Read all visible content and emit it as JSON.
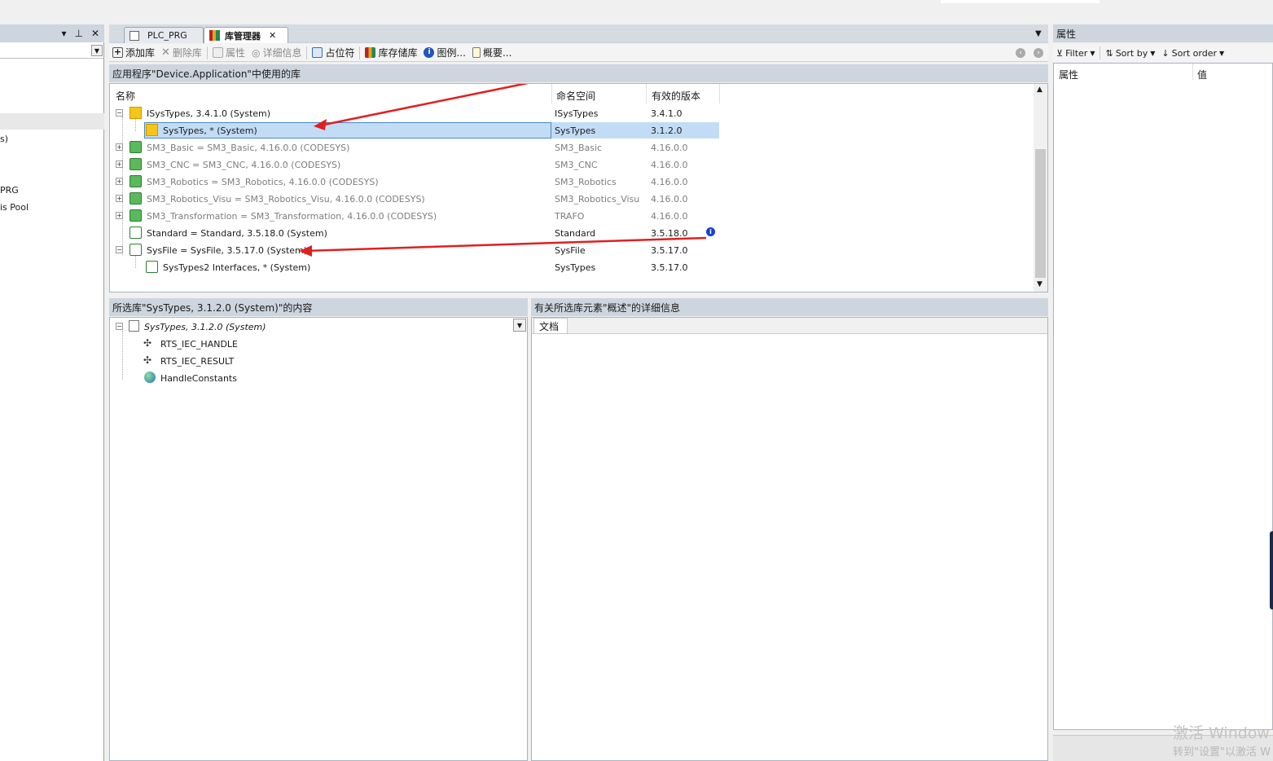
{
  "tabs": [
    {
      "label": "PLC_PRG"
    },
    {
      "label": "库管理器"
    }
  ],
  "left_panel": {
    "items": [
      "s)",
      "PRG",
      "is Pool"
    ]
  },
  "toolbar": {
    "add": "添加库",
    "remove": "删除库",
    "properties": "属性",
    "details": "详细信息",
    "placeholders": "占位符",
    "repository": "库存储库",
    "icons": "图例...",
    "summary": "概要..."
  },
  "libs_header": "应用程序\"Device.Application\"中使用的库",
  "columns": {
    "name": "名称",
    "namespace": "命名空间",
    "version": "有效的版本"
  },
  "libraries": [
    {
      "name": "ISysTypes, 3.4.1.0 (System)",
      "namespace": "ISysTypes",
      "version": "3.4.1.0"
    },
    {
      "name": "SysTypes, * (System)",
      "namespace": "SysTypes",
      "version": "3.1.2.0"
    },
    {
      "name": "SM3_Basic = SM3_Basic, 4.16.0.0 (CODESYS)",
      "namespace": "SM3_Basic",
      "version": "4.16.0.0"
    },
    {
      "name": "SM3_CNC = SM3_CNC, 4.16.0.0 (CODESYS)",
      "namespace": "SM3_CNC",
      "version": "4.16.0.0"
    },
    {
      "name": "SM3_Robotics = SM3_Robotics, 4.16.0.0 (CODESYS)",
      "namespace": "SM3_Robotics",
      "version": "4.16.0.0"
    },
    {
      "name": "SM3_Robotics_Visu = SM3_Robotics_Visu, 4.16.0.0 (CODESYS)",
      "namespace": "SM3_Robotics_Visu",
      "version": "4.16.0.0"
    },
    {
      "name": "SM3_Transformation = SM3_Transformation, 4.16.0.0 (CODESYS)",
      "namespace": "TRAFO",
      "version": "4.16.0.0"
    },
    {
      "name": "Standard = Standard, 3.5.18.0 (System)",
      "namespace": "Standard",
      "version": "3.5.18.0"
    },
    {
      "name": "SysFile = SysFile, 3.5.17.0 (System)",
      "namespace": "SysFile",
      "version": "3.5.17.0"
    },
    {
      "name": "SysTypes2 Interfaces, * (System)",
      "namespace": "SysTypes",
      "version": "3.5.17.0"
    }
  ],
  "content_header": "所选库\"SysTypes, 3.1.2.0 (System)\"的内容",
  "content_root": "SysTypes, 3.1.2.0 (System)",
  "content_items": [
    {
      "label": "RTS_IEC_HANDLE"
    },
    {
      "label": "RTS_IEC_RESULT"
    },
    {
      "label": "HandleConstants"
    }
  ],
  "detail_header": "有关所选库元素\"概述\"的详细信息",
  "detail_tab": "文档",
  "properties": {
    "title": "属性",
    "filter": "Filter",
    "sort_by": "Sort by",
    "sort_order": "Sort order",
    "col_property": "属性",
    "col_value": "值"
  },
  "watermark": {
    "line1": "激活 Window",
    "line2": "转到\"设置\"以激活 W"
  },
  "colors": {
    "header": "#cdd5df",
    "selection": "#c2dcf5",
    "arrow": "#e02020",
    "shield_green": "#5cb85c"
  }
}
